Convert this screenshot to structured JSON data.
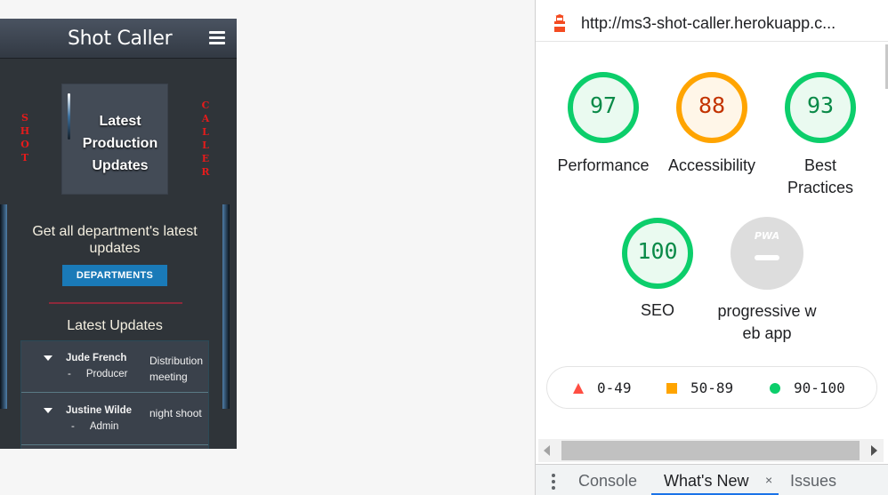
{
  "app": {
    "title": "Shot Caller",
    "side_left": [
      "S",
      "H",
      "O",
      "T"
    ],
    "side_right": [
      "C",
      "A",
      "L",
      "L",
      "E",
      "R"
    ],
    "card_title": "Latest Production Updates",
    "intro_text": "Get all department's latest updates",
    "departments_button": "DEPARTMENTS",
    "latest_heading": "Latest Updates",
    "updates": [
      {
        "name": "Jude French",
        "role": "Producer",
        "description": "Distribution meeting"
      },
      {
        "name": "Justine Wilde",
        "role": "Admin",
        "description": "night shoot"
      }
    ]
  },
  "devtools": {
    "url": "http://ms3-shot-caller.herokuapp.c...",
    "scores": [
      {
        "value": "97",
        "label": "Performance",
        "color": "#0cce6b"
      },
      {
        "value": "88",
        "label": "Accessibility",
        "color": "#ffa400"
      },
      {
        "value": "93",
        "label": "Best Practices",
        "color": "#0cce6b"
      },
      {
        "value": "100",
        "label": "SEO",
        "color": "#0cce6b"
      }
    ],
    "pwa": {
      "badge": "PWA",
      "label": "progressive web app"
    },
    "legend": [
      {
        "range": "0-49",
        "color": "#ff4e42",
        "shape": "triangle"
      },
      {
        "range": "50-89",
        "color": "#ffa400",
        "shape": "square"
      },
      {
        "range": "90-100",
        "color": "#0cce6b",
        "shape": "circle"
      }
    ],
    "drawer_tabs": {
      "console": "Console",
      "whats_new": "What's New",
      "issues": "Issues",
      "close": "×"
    }
  }
}
